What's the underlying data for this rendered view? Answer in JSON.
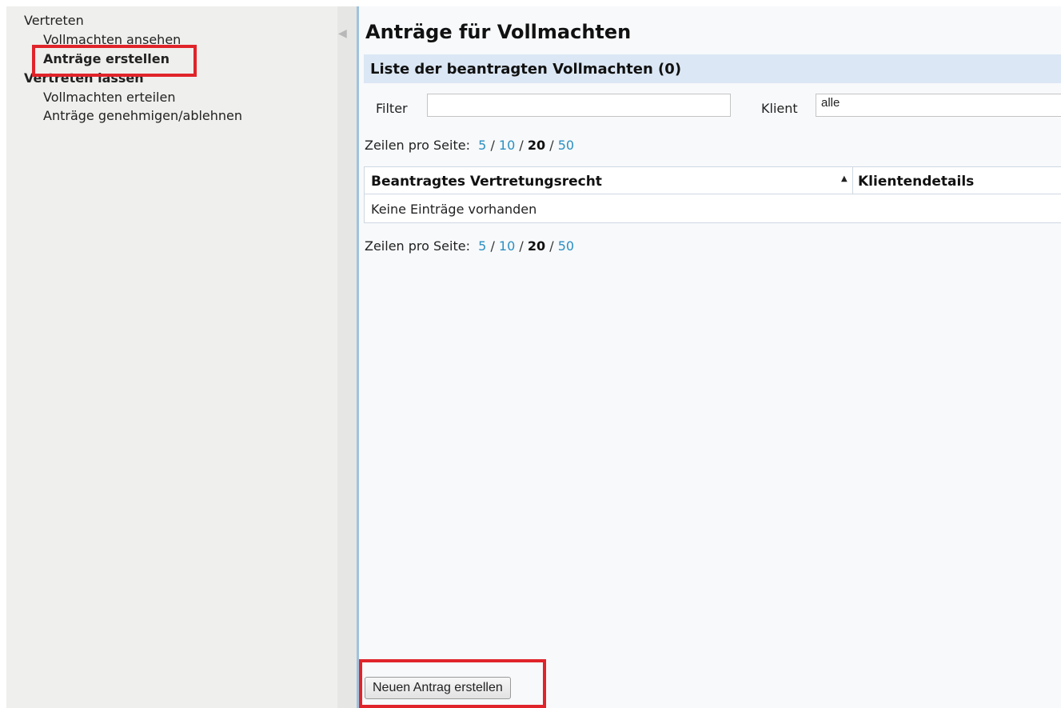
{
  "sidebar": {
    "group_represent": "Vertreten",
    "item_view_powers": "Vollmachten ansehen",
    "item_create_requests": "Anträge erstellen",
    "group_be_represented": "Vertreten lassen",
    "item_grant_powers": "Vollmachten erteilen",
    "item_approve_requests": "Anträge genehmigen/ablehnen"
  },
  "splitter": {
    "collapse_icon": "collapse-left-arrow-icon"
  },
  "main": {
    "title": "Anträge für Vollmachten",
    "section_title": "Liste der beantragten Vollmachten (0)",
    "filter_label": "Filter",
    "filter_value": "",
    "client_label": "Klient",
    "client_value": "alle",
    "pager": {
      "label": "Zeilen pro Seite:",
      "options": [
        "5",
        "10",
        "20",
        "50"
      ],
      "selected": "20",
      "separator": "/"
    },
    "table": {
      "columns": [
        "Beantragtes Vertretungsrecht",
        "Klientendetails"
      ],
      "sort_icon": "sort-ascending-icon",
      "empty_text": "Keine Einträge vorhanden"
    },
    "new_request_button": "Neuen Antrag erstellen"
  },
  "colors": {
    "highlight": "#e0242a",
    "link": "#2b8fc1",
    "section_bar": "#dbe7f4",
    "sidebar_bg": "#efefed",
    "main_border": "#9fc2de"
  }
}
